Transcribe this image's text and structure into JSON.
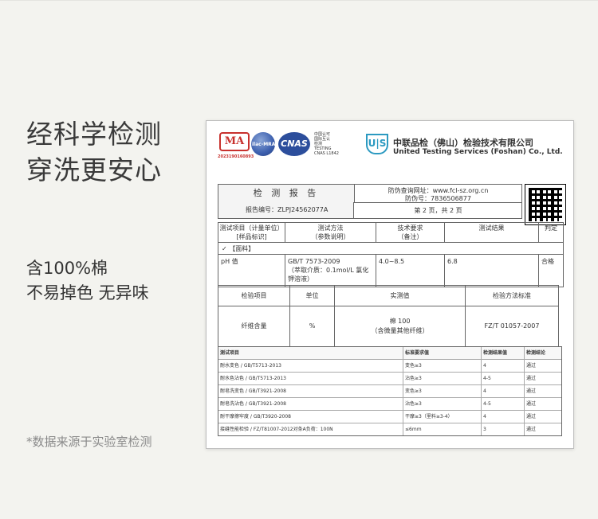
{
  "left": {
    "headline": [
      "经科学检测",
      "穿洗更安心"
    ],
    "sub": [
      "含100%棉",
      "不易掉色 无异味"
    ],
    "note": "*数据来源于实验室检测"
  },
  "doc": {
    "cma_label": "MA",
    "cma_number": "2023190160893",
    "ilac_label": "ilac-MRA",
    "cnas_label": "CNAS",
    "cnas_side": [
      "中国认可",
      "国际互认",
      "检测",
      "TESTING",
      "CNAS L1842"
    ],
    "company_logo": "U|S",
    "company_cn": "中联品检（佛山）检验技术有限公司",
    "company_en": "United Testing Services (Foshan) Co., Ltd.",
    "report_title": "检 测 报 告",
    "report_number": "报告编号：ZLPJ24562077A",
    "web_line1": "防伪查询网址：www.fcl-sz.org.cn",
    "web_line2": "防伪号：7836506877",
    "page": "第 2 页，共 2 页",
    "t1": {
      "headers": [
        "测试项目（计量单位）\n[样品标识]",
        "测试方法\n（参数说明）",
        "技术要求\n（备注）",
        "测试结果",
        "判定"
      ],
      "band": "✓ 【面料】",
      "row": [
        "pH 值",
        "GB/T 7573-2009\n（萃取介质：0.1mol/L 氯化钾溶液）",
        "4.0~8.5",
        "6.8",
        "合格"
      ]
    },
    "t2": {
      "headers": [
        "检验项目",
        "单位",
        "实测值",
        "检验方法标准"
      ],
      "item": "纤维含量",
      "unit": "%",
      "value": "棉 100\n（含微量其他纤维）",
      "method": "FZ/T 01057-2007"
    },
    "t3": {
      "headers": [
        "测试项目",
        "标准要求值",
        "检测结果值",
        "检测结论"
      ],
      "rows": [
        [
          "耐水变色 / GB/T5713-2013",
          "变色≥3",
          "4",
          "通过"
        ],
        [
          "耐水色沾色 / GB/T5713-2013",
          "沾色≥3",
          "4-5",
          "通过"
        ],
        [
          "耐皂洗变色 / GB/T3921-2008",
          "变色≥3",
          "4",
          "通过"
        ],
        [
          "耐皂洗沾色 / GB/T3921-2008",
          "沾色≥3",
          "4-5",
          "通过"
        ],
        [
          "耐干摩擦牢度 / GB/T3920-2008",
          "干摩≥3（里料≥3-4）",
          "4",
          "通过"
        ],
        [
          "接缝性能检验 / FZ/T81007-2012对条A负荷：100N",
          "≤6mm",
          "3",
          "通过"
        ]
      ]
    }
  }
}
